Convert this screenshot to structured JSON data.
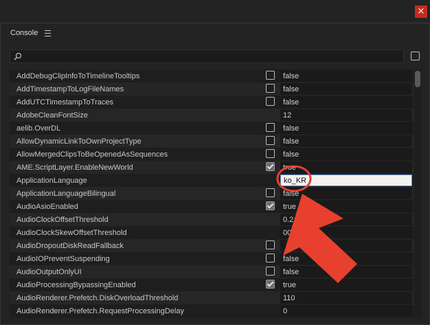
{
  "window": {
    "close_glyph": "×"
  },
  "panel": {
    "title": "Console",
    "menu_icon": "hamburger-menu-icon"
  },
  "search": {
    "value": "",
    "icon": "search-icon"
  },
  "rows": [
    {
      "name": "AddDebugClipInfoToTimelineTooltips",
      "value": "false",
      "has_checkbox": true,
      "checked": false
    },
    {
      "name": "AddTimestampToLogFileNames",
      "value": "false",
      "has_checkbox": true,
      "checked": false
    },
    {
      "name": "AddUTCTimestampToTraces",
      "value": "false",
      "has_checkbox": true,
      "checked": false
    },
    {
      "name": "AdobeCleanFontSize",
      "value": "12",
      "has_checkbox": false,
      "checked": false
    },
    {
      "name": "aelib.OverDL",
      "value": "false",
      "has_checkbox": true,
      "checked": false
    },
    {
      "name": "AllowDynamicLinkToOwnProjectType",
      "value": "false",
      "has_checkbox": true,
      "checked": false
    },
    {
      "name": "AllowMergedClipsToBeOpenedAsSequences",
      "value": "false",
      "has_checkbox": true,
      "checked": false
    },
    {
      "name": "AME.ScriptLayer.EnableNewWorld",
      "value": "true",
      "has_checkbox": true,
      "checked": true
    },
    {
      "name": "ApplicationLanguage",
      "value": "ko_KR",
      "has_checkbox": false,
      "checked": false,
      "editing": true
    },
    {
      "name": "ApplicationLanguageBilingual",
      "value": "false",
      "has_checkbox": true,
      "checked": false
    },
    {
      "name": "AudioAsioEnabled",
      "value": "true",
      "has_checkbox": true,
      "checked": true
    },
    {
      "name": "AudioClockOffsetThreshold",
      "value": "0.2",
      "has_checkbox": false,
      "checked": false
    },
    {
      "name": "AudioClockSkewOffsetThreshold",
      "value": "00001",
      "has_checkbox": false,
      "checked": false
    },
    {
      "name": "AudioDropoutDiskReadFallback",
      "value": "",
      "has_checkbox": true,
      "checked": false
    },
    {
      "name": "AudioIOPreventSuspending",
      "value": "false",
      "has_checkbox": true,
      "checked": false
    },
    {
      "name": "AudioOutputOnlyUI",
      "value": "false",
      "has_checkbox": true,
      "checked": false
    },
    {
      "name": "AudioProcessingBypassingEnabled",
      "value": "true",
      "has_checkbox": true,
      "checked": true
    },
    {
      "name": "AudioRenderer.Prefetch.DiskOverloadThreshold",
      "value": "110",
      "has_checkbox": false,
      "checked": false
    },
    {
      "name": "AudioRenderer.Prefetch.RequestProcessingDelay",
      "value": "0",
      "has_checkbox": false,
      "checked": false
    }
  ],
  "annotation": {
    "arrow_color": "#e8402f",
    "circle_color": "#e8402f"
  }
}
